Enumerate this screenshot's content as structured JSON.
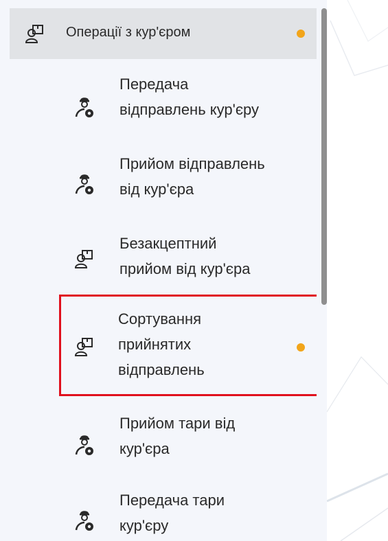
{
  "sidebar": {
    "group": {
      "label": "Операції з кур'єром",
      "icon": "box-person-icon",
      "has_indicator": true
    },
    "items": [
      {
        "lines": [
          "Передача",
          "відправлень кур'єру"
        ],
        "icon": "courier-person-icon",
        "has_indicator": false
      },
      {
        "lines": [
          "Прийом відправлень",
          "від кур'єра"
        ],
        "icon": "courier-person-icon",
        "has_indicator": false
      },
      {
        "lines": [
          "Безакцептний",
          "прийом від кур'єра"
        ],
        "icon": "box-person-icon",
        "has_indicator": false
      },
      {
        "lines": [
          "Сортування",
          "прийнятих",
          "відправлень"
        ],
        "icon": "box-person-icon",
        "has_indicator": true,
        "highlighted": true
      },
      {
        "lines": [
          "Прийом тари від",
          "кур'єра"
        ],
        "icon": "courier-person-icon",
        "has_indicator": false
      },
      {
        "lines": [
          "Передача тари",
          "кур'єру"
        ],
        "icon": "courier-person-icon",
        "has_indicator": false
      }
    ]
  },
  "colors": {
    "indicator": "#f2a51a",
    "highlight_border": "#e0101d",
    "group_header_bg": "#e1e3e6",
    "sidebar_bg": "#f4f6fb",
    "text": "#2a2a2a"
  }
}
